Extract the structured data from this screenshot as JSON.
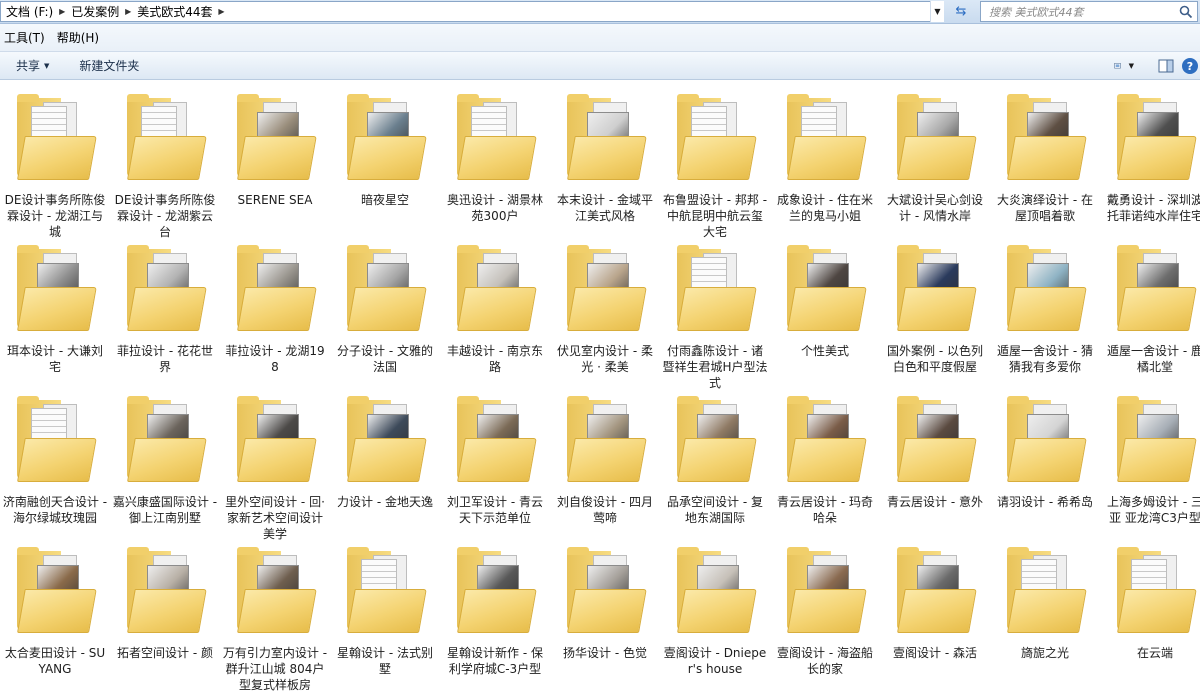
{
  "address": {
    "crumbs": [
      "文档 (F:)",
      "已发案例",
      "美式欧式44套"
    ],
    "search_placeholder": "搜索 美式欧式44套"
  },
  "menu": {
    "items": [
      "工具(T)",
      "帮助(H)"
    ]
  },
  "commandbar": {
    "share_label": "共享",
    "new_folder_label": "新建文件夹"
  },
  "folders": [
    {
      "label": "DE设计事务所陈俊霖设计 - 龙湖江与城",
      "thumb": "paper"
    },
    {
      "label": "DE设计事务所陈俊霖设计 - 龙湖紫云台",
      "thumb": "paper"
    },
    {
      "label": "SERENE SEA",
      "thumb": "photo",
      "tint": "#9a8e7c"
    },
    {
      "label": "暗夜星空",
      "thumb": "photo",
      "tint": "#6a7f8e"
    },
    {
      "label": "奥迅设计 - 湖景林苑300户",
      "thumb": "paper"
    },
    {
      "label": "本末设计 - 金域平江美式风格",
      "thumb": "photo",
      "tint": "#cfcfcf"
    },
    {
      "label": "布鲁盟设计 - 邦邦 - 中航昆明中航云玺大宅",
      "thumb": "paper"
    },
    {
      "label": "成象设计 - 住在米兰的鬼马小姐",
      "thumb": "paper"
    },
    {
      "label": "大斌设计吴心剑设计 - 风情水岸",
      "thumb": "photo",
      "tint": "#a9a9a9"
    },
    {
      "label": "大炎演绎设计 - 在屋顶唱着歌",
      "thumb": "photo",
      "tint": "#5e4f43"
    },
    {
      "label": "戴勇设计 - 深圳波托菲诺纯水岸住宅",
      "thumb": "photo",
      "tint": "#4f4f4f"
    },
    {
      "label": "珥本设计 - 大谦刘宅",
      "thumb": "photo",
      "tint": "#8f8f8f"
    },
    {
      "label": "菲拉设计 - 花花世界",
      "thumb": "photo",
      "tint": "#b3b3b3"
    },
    {
      "label": "菲拉设计 - 龙湖198",
      "thumb": "photo",
      "tint": "#9a968f"
    },
    {
      "label": "分子设计 - 文雅的法国",
      "thumb": "photo",
      "tint": "#a6a6a6"
    },
    {
      "label": "丰越设计 - 南京东路",
      "thumb": "photo",
      "tint": "#c4c0ba"
    },
    {
      "label": "伏见室内设计 - 柔光 · 柔美",
      "thumb": "photo",
      "tint": "#b9a58c"
    },
    {
      "label": "付雨鑫陈设计 - 诸暨祥生君城H户型法式",
      "thumb": "paper"
    },
    {
      "label": "个性美式",
      "thumb": "photo",
      "tint": "#4e4642"
    },
    {
      "label": "国外案例 - 以色列白色和平度假屋",
      "thumb": "photo",
      "tint": "#2a3a5c"
    },
    {
      "label": "遁屋一舍设计 - 猜猜我有多爱你",
      "thumb": "photo",
      "tint": "#8fb3c4"
    },
    {
      "label": "遁屋一舍设计 - 鹿橘北堂",
      "thumb": "photo",
      "tint": "#6d6d6d"
    },
    {
      "label": "济南融创天合设计 - 海尔绿城玫瑰园",
      "thumb": "paper"
    },
    {
      "label": "嘉兴康盛国际设计 - 御上江南别墅",
      "thumb": "photo",
      "tint": "#6b645c"
    },
    {
      "label": "里外空间设计 - 回·家新艺术空间设计美学",
      "thumb": "photo",
      "tint": "#4c4a48"
    },
    {
      "label": "力设计 - 金地天逸",
      "thumb": "photo",
      "tint": "#3d4a5a"
    },
    {
      "label": "刘卫军设计 - 青云天下示范单位",
      "thumb": "photo",
      "tint": "#7b6a56"
    },
    {
      "label": "刘自俊设计 - 四月莺啼",
      "thumb": "photo",
      "tint": "#a3957f"
    },
    {
      "label": "品承空间设计 - 复地东湖国际",
      "thumb": "photo",
      "tint": "#8f7a64"
    },
    {
      "label": "青云居设计 - 玛奇哈朵",
      "thumb": "photo",
      "tint": "#7a5c48"
    },
    {
      "label": "青云居设计 - 意外",
      "thumb": "photo",
      "tint": "#5a4a40"
    },
    {
      "label": "请羽设计 - 希希岛",
      "thumb": "photo",
      "tint": "#d4d4d4"
    },
    {
      "label": "上海多姆设计 - 三亚 亚龙湾C3户型",
      "thumb": "photo",
      "tint": "#a7aeb6"
    },
    {
      "label": "太合麦田设计 - SU YANG",
      "thumb": "photo",
      "tint": "#8a6a4a"
    },
    {
      "label": "拓者空间设计 - 颜",
      "thumb": "photo",
      "tint": "#b8b0a6"
    },
    {
      "label": "万有引力室内设计 - 群升江山城 804户型复式样板房",
      "thumb": "photo",
      "tint": "#6e5e4e"
    },
    {
      "label": "星翰设计 - 法式别墅",
      "thumb": "paper"
    },
    {
      "label": "星翰设计新作 - 保利学府城C-3户型",
      "thumb": "photo",
      "tint": "#585858"
    },
    {
      "label": "扬华设计 - 色觉",
      "thumb": "photo",
      "tint": "#a5a09a"
    },
    {
      "label": "壹阁设计 - Dnieper's house",
      "thumb": "photo",
      "tint": "#c6c0b8"
    },
    {
      "label": "壹阁设计 - 海盗船长的家",
      "thumb": "photo",
      "tint": "#8a6a50"
    },
    {
      "label": "壹阁设计 - 森活",
      "thumb": "photo",
      "tint": "#6a6a6a"
    },
    {
      "label": "旖旎之光",
      "thumb": "paper"
    },
    {
      "label": "在云端",
      "thumb": "paper"
    }
  ]
}
